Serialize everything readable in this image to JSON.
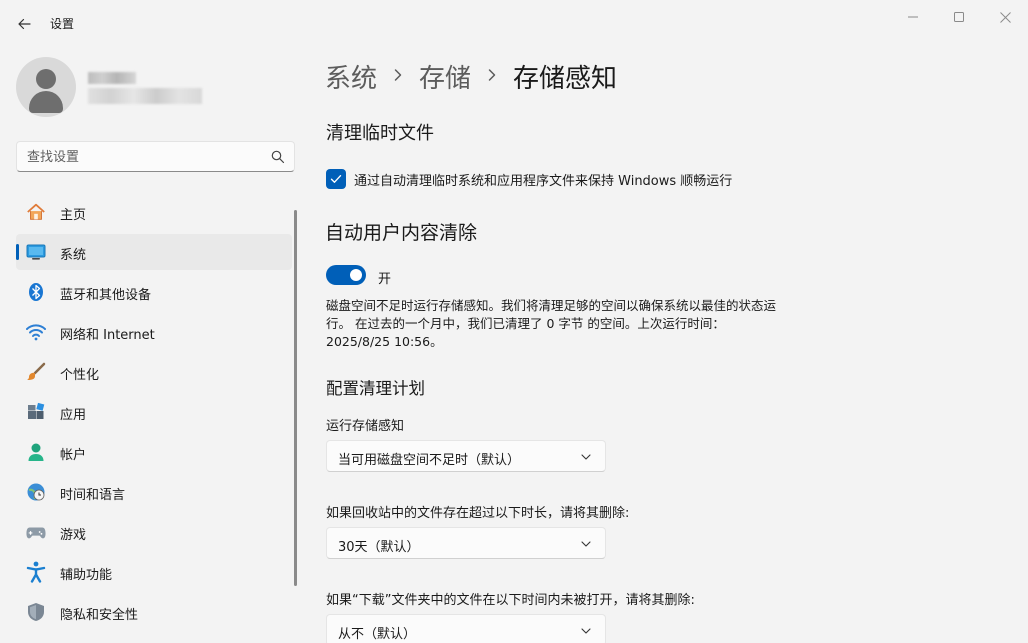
{
  "window": {
    "title": "设置",
    "controls": [
      "minimize",
      "maximize",
      "close"
    ]
  },
  "search": {
    "placeholder": "查找设置"
  },
  "nav": {
    "items": [
      {
        "label": "主页",
        "icon": "home-icon"
      },
      {
        "label": "系统",
        "icon": "system-icon",
        "active": true
      },
      {
        "label": "蓝牙和其他设备",
        "icon": "bluetooth-icon"
      },
      {
        "label": "网络和 Internet",
        "icon": "wifi-icon"
      },
      {
        "label": "个性化",
        "icon": "brush-icon"
      },
      {
        "label": "应用",
        "icon": "apps-icon"
      },
      {
        "label": "帐户",
        "icon": "account-icon"
      },
      {
        "label": "时间和语言",
        "icon": "globe-clock-icon"
      },
      {
        "label": "游戏",
        "icon": "gamepad-icon"
      },
      {
        "label": "辅助功能",
        "icon": "accessibility-icon"
      },
      {
        "label": "隐私和安全性",
        "icon": "shield-icon"
      }
    ]
  },
  "breadcrumb": {
    "items": [
      "系统",
      "存储"
    ],
    "current": "存储感知"
  },
  "cleanup": {
    "heading": "清理临时文件",
    "checkbox_label": "通过自动清理临时系统和应用程序文件来保持 Windows 顺畅运行",
    "checked": true
  },
  "auto_cleanup": {
    "heading": "自动用户内容清除",
    "toggle_label": "开",
    "toggle_on": true,
    "description": "磁盘空间不足时运行存储感知。我们将清理足够的空间以确保系统以最佳的状态运行。 在过去的一个月中，我们已清理了 0 字节 的空间。上次运行时间：2025/8/25 10:56。"
  },
  "schedule": {
    "heading": "配置清理计划",
    "run_label": "运行存储感知",
    "run_value": "当可用磁盘空间不足时（默认）",
    "recycle_label": "如果回收站中的文件存在超过以下时长，请将其删除:",
    "recycle_value": "30天（默认）",
    "downloads_label": "如果“下载”文件夹中的文件在以下时间内未被打开，请将其删除:",
    "downloads_value": "从不（默认）"
  },
  "colors": {
    "accent": "#005fb8",
    "background": "#f3f3f3"
  }
}
